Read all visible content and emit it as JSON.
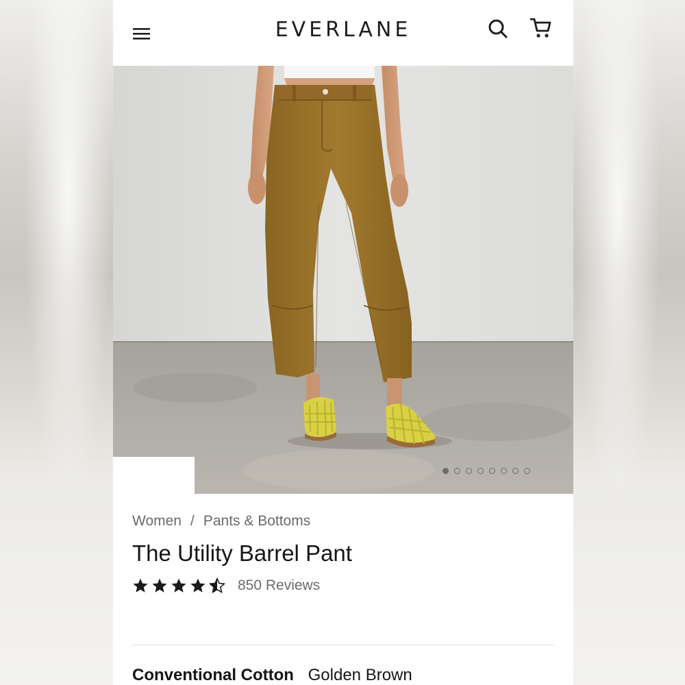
{
  "header": {
    "logo": "EVERLANE",
    "icons": [
      "menu-icon",
      "search-icon",
      "cart-icon"
    ]
  },
  "gallery": {
    "image_alt": "Model wearing golden brown barrel pants with yellow woven sandals",
    "dot_count": 8,
    "active_index": 0
  },
  "breadcrumb": {
    "items": [
      "Women",
      "Pants & Bottoms"
    ],
    "separator": "/"
  },
  "product": {
    "title": "The Utility Barrel Pant",
    "rating": 4.5,
    "reviews_label": "850 Reviews"
  },
  "variant": {
    "material": "Conventional Cotton",
    "color": "Golden Brown"
  },
  "colors": {
    "pant": "#9a7329",
    "sandal": "#d9d144",
    "text": "#151515",
    "muted": "#6a6a6a"
  }
}
